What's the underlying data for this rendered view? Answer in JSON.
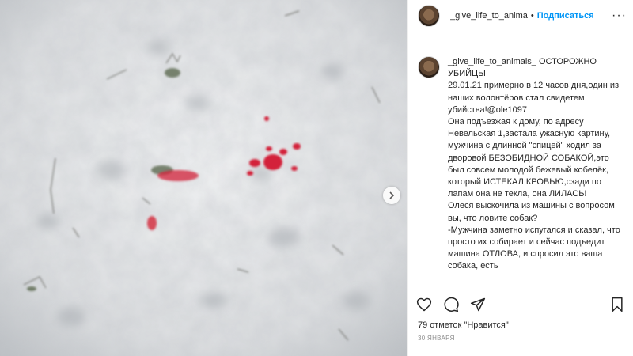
{
  "post": {
    "username": "_give_life_to_anima",
    "separator": "•",
    "follow_label": "Подписаться",
    "more_label": "···",
    "caption_author": "_give_life_to_animals_",
    "caption_text": " ОСТОРОЖНО УБИЙЦЫ\n29.01.21 примерно в 12 часов дня,один из наших волонтёров стал свидетем убийства!@ole1097\nОна подъезжая к дому, по адресу Невельская 1,застала ужасную картину, мужчина с длинной \"спицей\" ходил за дворовой БЕЗОБИДНОЙ СОБАКОЙ,это был совсем молодой бежевый кобелёк, который ИСТЕКАЛ КРОВЬЮ,сзади по лапам она не текла, она ЛИЛАСЬ!\nОлеся выскочила из машины с вопросом вы, что ловите собак?\n-Мужчина заметно испугался и сказал, что просто их собирает и сейчас подъедит машина ОТЛОВА, и спросил это ваша собака, есть",
    "likes_count": "79",
    "likes_text": " отметок «Нравится»",
    "likes_line": "79 отметок \"Нравится\"",
    "date": "30 ЯНВАРЯ"
  },
  "icons": [
    "heart-icon",
    "comment-icon",
    "share-icon",
    "bookmark-icon",
    "chevron-right-icon"
  ],
  "colors": {
    "accent": "#0095f6",
    "text": "#262626",
    "muted": "#8e8e8e",
    "blood": "#d3243a"
  }
}
